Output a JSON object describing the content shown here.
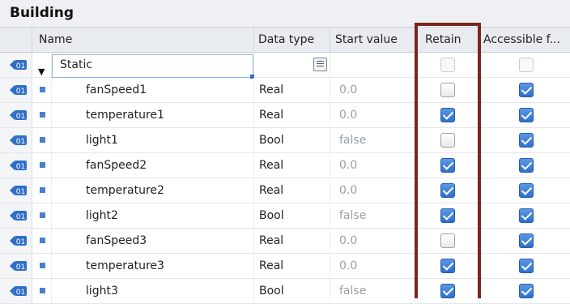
{
  "block_title": "Building",
  "columns": {
    "name": "Name",
    "data_type": "Data type",
    "start_value": "Start value",
    "retain": "Retain",
    "accessible": "Accessible f..."
  },
  "section": {
    "label": "Static",
    "icon": "db-tag-icon",
    "retain": false,
    "accessible": false
  },
  "rows": [
    {
      "name": "fanSpeed1",
      "type": "Real",
      "start": "0.0",
      "retain": false,
      "accessible": true
    },
    {
      "name": "temperature1",
      "type": "Real",
      "start": "0.0",
      "retain": true,
      "accessible": true
    },
    {
      "name": "light1",
      "type": "Bool",
      "start": "false",
      "retain": false,
      "accessible": true
    },
    {
      "name": "fanSpeed2",
      "type": "Real",
      "start": "0.0",
      "retain": true,
      "accessible": true
    },
    {
      "name": "temperature2",
      "type": "Real",
      "start": "0.0",
      "retain": true,
      "accessible": true
    },
    {
      "name": "light2",
      "type": "Bool",
      "start": "false",
      "retain": true,
      "accessible": true
    },
    {
      "name": "fanSpeed3",
      "type": "Real",
      "start": "0.0",
      "retain": false,
      "accessible": true
    },
    {
      "name": "temperature3",
      "type": "Real",
      "start": "0.0",
      "retain": true,
      "accessible": true
    },
    {
      "name": "light3",
      "type": "Bool",
      "start": "false",
      "retain": true,
      "accessible": true
    }
  ],
  "colors": {
    "highlight": "#7a2620",
    "checkbox_on": "#2e6fcc",
    "selection": "#8fb4e3"
  }
}
